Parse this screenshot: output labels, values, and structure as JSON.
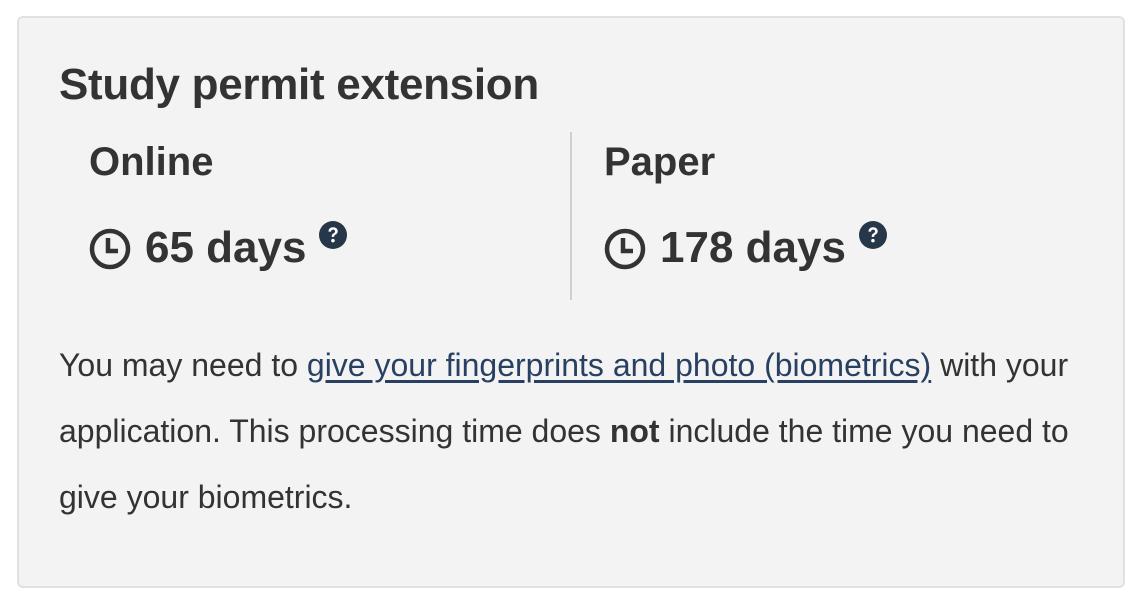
{
  "card": {
    "title": "Study permit extension",
    "online": {
      "label": "Online",
      "time": "65 days",
      "clock_icon": "clock-icon",
      "help_icon": "question-circle-icon"
    },
    "paper": {
      "label": "Paper",
      "time": "178 days",
      "clock_icon": "clock-icon",
      "help_icon": "question-circle-icon"
    },
    "notice": {
      "before_link": "You may need to ",
      "link_text": "give your fingerprints and photo (biometrics)",
      "after_link": " with your application. This processing time does ",
      "bold_word": "not",
      "end": " include the time you need to give your biometrics."
    }
  },
  "colors": {
    "card_background": "#f3f3f3",
    "card_border": "#e1e1e1",
    "text": "#333333",
    "link": "#284162",
    "help_icon": "#26374a",
    "divider": "#cfcfcf"
  }
}
